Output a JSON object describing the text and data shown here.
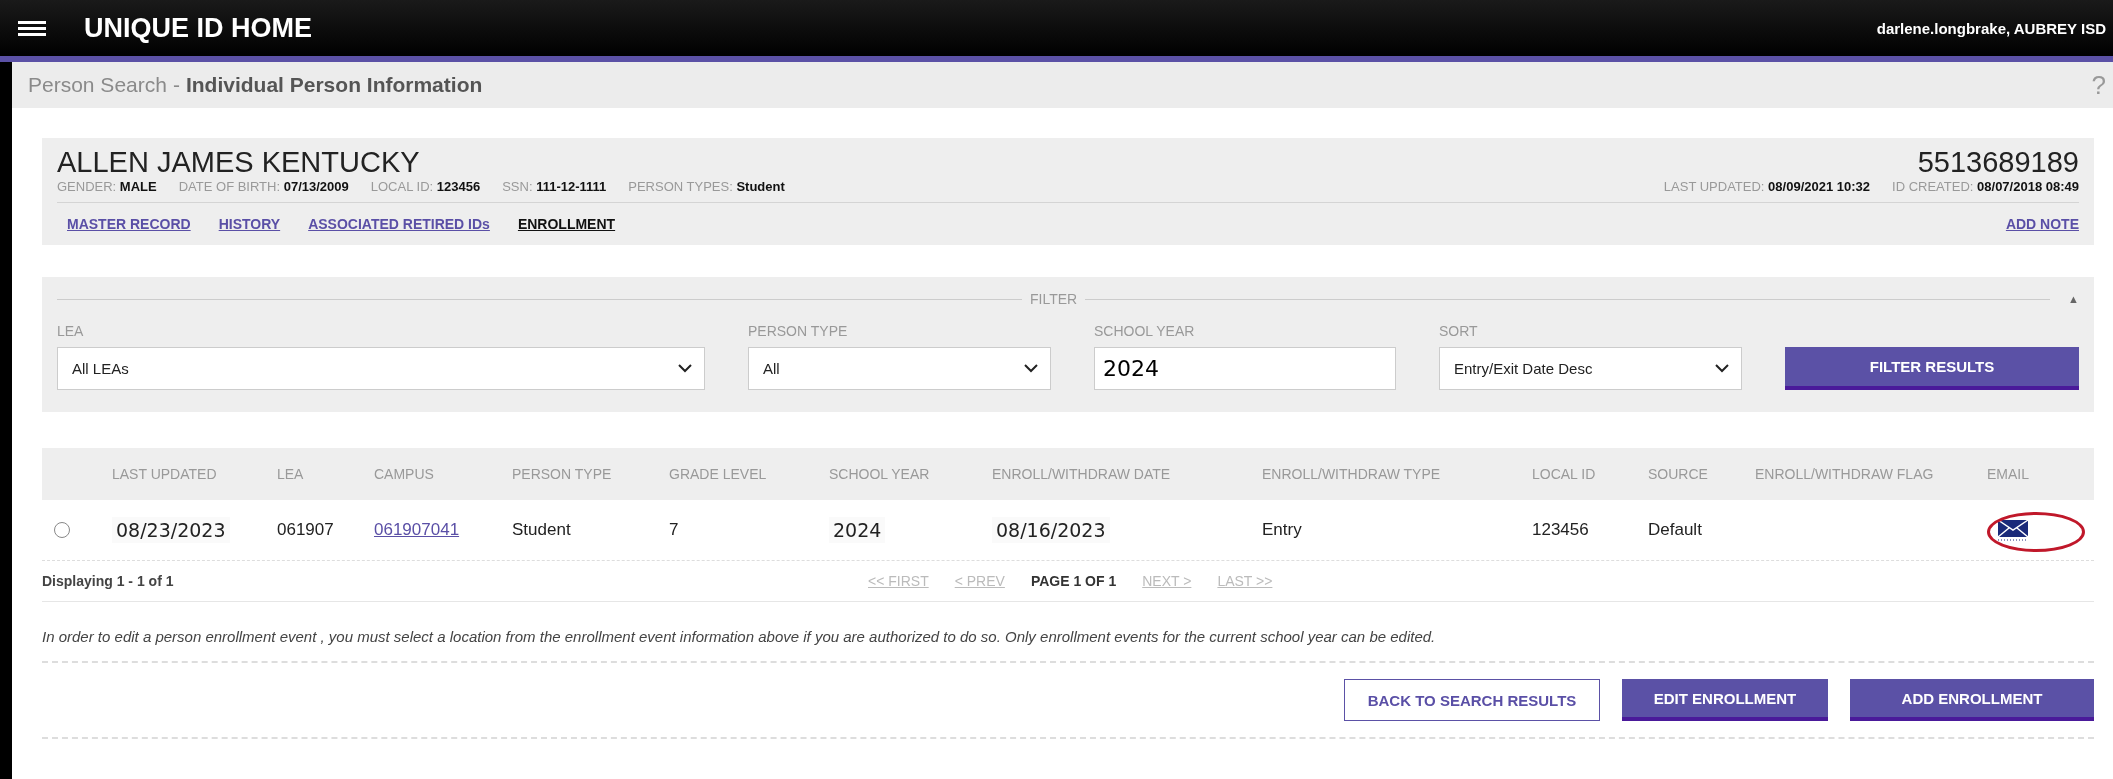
{
  "header": {
    "title": "UNIQUE ID HOME",
    "user": "darlene.longbrake, AUBREY ISD"
  },
  "breadcrumb": {
    "parent": "Person Search",
    "separator": "-",
    "current": "Individual Person Information",
    "help": "?"
  },
  "person": {
    "name": "ALLEN JAMES KENTUCKY",
    "id": "5513689189",
    "fields": [
      {
        "label": "GENDER:",
        "value": "MALE"
      },
      {
        "label": "DATE OF BIRTH:",
        "value": "07/13/2009"
      },
      {
        "label": "LOCAL ID:",
        "value": "123456"
      },
      {
        "label": "SSN:",
        "value": "111-12-1111"
      },
      {
        "label": "PERSON TYPES:",
        "value": "Student"
      }
    ],
    "meta": [
      {
        "label": "LAST UPDATED:",
        "value": "08/09/2021 10:32"
      },
      {
        "label": "ID CREATED:",
        "value": "08/07/2018 08:49"
      }
    ]
  },
  "tabs": [
    {
      "label": "MASTER RECORD",
      "selected": false
    },
    {
      "label": "HISTORY",
      "selected": false
    },
    {
      "label": "ASSOCIATED RETIRED IDs",
      "selected": false
    },
    {
      "label": "ENROLLMENT",
      "selected": true
    }
  ],
  "add_note": "ADD NOTE",
  "filter": {
    "title": "FILTER",
    "collapse": "▲",
    "fields": [
      {
        "label": "LEA",
        "kind": "select",
        "value": "All LEAs"
      },
      {
        "label": "PERSON TYPE",
        "kind": "select",
        "value": "All"
      },
      {
        "label": "SCHOOL YEAR",
        "kind": "input",
        "value": "2024"
      },
      {
        "label": "SORT",
        "kind": "select",
        "value": "Entry/Exit Date Desc"
      }
    ],
    "button": "FILTER RESULTS"
  },
  "table": {
    "columns": [
      "LAST UPDATED",
      "LEA",
      "CAMPUS",
      "PERSON TYPE",
      "GRADE LEVEL",
      "SCHOOL YEAR",
      "ENROLL/WITHDRAW DATE",
      "ENROLL/WITHDRAW TYPE",
      "LOCAL ID",
      "SOURCE",
      "ENROLL/WITHDRAW FLAG",
      "EMAIL"
    ],
    "rows": [
      {
        "selected": false,
        "email_highlighted": true,
        "cells": [
          {
            "text": "08/23/2023",
            "kind": "pasted"
          },
          {
            "text": "061907",
            "kind": "plain"
          },
          {
            "text": "061907041",
            "kind": "link"
          },
          {
            "text": "Student",
            "kind": "plain"
          },
          {
            "text": "7",
            "kind": "plain"
          },
          {
            "text": "2024",
            "kind": "pasted"
          },
          {
            "text": "08/16/2023",
            "kind": "pasted"
          },
          {
            "text": "Entry",
            "kind": "plain"
          },
          {
            "text": "123456",
            "kind": "plain"
          },
          {
            "text": "Default",
            "kind": "plain"
          }
        ]
      }
    ]
  },
  "pagination": {
    "summary": "Displaying 1 - 1 of 1",
    "links": [
      {
        "label": "<< FIRST",
        "kind": "link",
        "disabled": true
      },
      {
        "label": "< PREV",
        "kind": "link",
        "disabled": true
      },
      {
        "label": "PAGE 1 OF 1",
        "kind": "current",
        "disabled": false
      },
      {
        "label": "NEXT >",
        "kind": "link",
        "disabled": true
      },
      {
        "label": "LAST >>",
        "kind": "link",
        "disabled": true
      }
    ]
  },
  "note": "In order to edit a person enrollment event , you must select a location from the enrollment event information above if you are authorized to do so. Only enrollment events for the current school year can be edited.",
  "buttons": [
    {
      "label": "BACK TO SEARCH RESULTS",
      "kind": "outline"
    },
    {
      "label": "EDIT ENROLLMENT",
      "kind": "primary"
    },
    {
      "label": "ADD ENROLLMENT",
      "kind": "primary"
    }
  ]
}
